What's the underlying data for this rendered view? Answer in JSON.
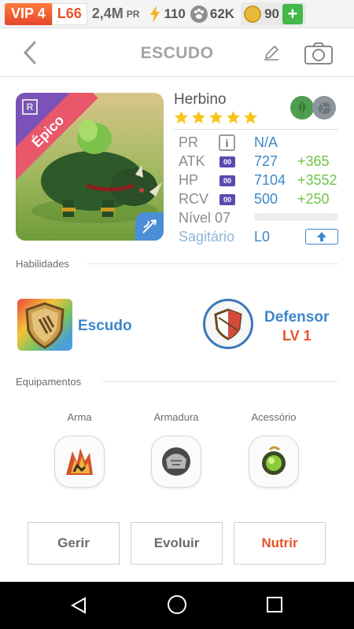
{
  "status": {
    "vip": "VIP 4",
    "level": "L66",
    "pr_value": "2,4M",
    "pr_unit": "PR",
    "energy": "110",
    "paw": "62K",
    "coins": "90",
    "plus": "+"
  },
  "header": {
    "title": "ESCUDO"
  },
  "hero": {
    "rank_badge": "R",
    "rarity": "Épico",
    "name": "Herbino",
    "stars": 5
  },
  "stats": {
    "pr": {
      "label": "PR",
      "info": "i",
      "value": "N/A"
    },
    "atk": {
      "label": "ATK",
      "chip": "00",
      "value": "727",
      "bonus": "+365"
    },
    "hp": {
      "label": "HP",
      "chip": "00",
      "value": "7104",
      "bonus": "+3552"
    },
    "rcv": {
      "label": "RCV",
      "chip": "00",
      "value": "500",
      "bonus": "+250"
    },
    "level": {
      "label": "Nível 07"
    },
    "sign": {
      "label": "Sagitário",
      "value": "L0"
    }
  },
  "abilities": {
    "section_title": "Habilidades",
    "skill_name": "Escudo",
    "passive_name": "Defensor",
    "passive_level": "LV 1"
  },
  "equipment": {
    "section_title": "Equipamentos",
    "slots": [
      "Arma",
      "Armadura",
      "Acessório"
    ]
  },
  "buttons": {
    "manage": "Gerir",
    "evolve": "Evoluir",
    "feed": "Nutrir"
  },
  "colors": {
    "accent_blue": "#3d87c9",
    "accent_orange": "#e8532b",
    "bonus_green": "#6fc445",
    "rarity_pink": "#e9576b"
  }
}
